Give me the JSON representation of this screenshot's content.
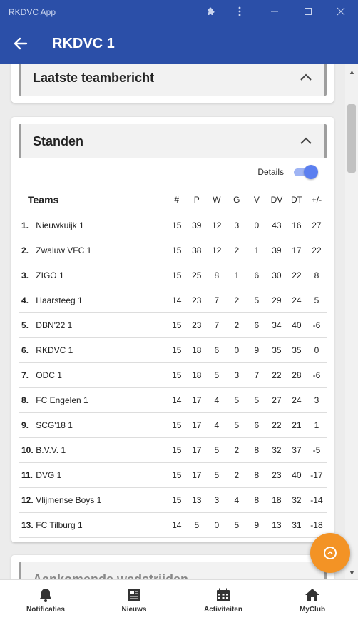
{
  "window": {
    "title": "RKDVC App"
  },
  "appbar": {
    "title": "RKDVC 1"
  },
  "sections": {
    "laatste": {
      "title": "Laatste teambericht"
    },
    "standen": {
      "title": "Standen",
      "details_label": "Details",
      "details_on": true
    },
    "aankomende": {
      "title": "Aankomende wedstrijden"
    }
  },
  "table": {
    "headers": {
      "teams": "Teams",
      "pos": "#",
      "p": "P",
      "w": "W",
      "g": "G",
      "v": "V",
      "dv": "DV",
      "dt": "DT",
      "diff": "+/-"
    },
    "rows": [
      {
        "pos": "1.",
        "team": "Nieuwkuijk 1",
        "played": "15",
        "points": "39",
        "w": "12",
        "g": "3",
        "v": "0",
        "dv": "43",
        "dt": "16",
        "diff": "27"
      },
      {
        "pos": "2.",
        "team": "Zwaluw VFC 1",
        "played": "15",
        "points": "38",
        "w": "12",
        "g": "2",
        "v": "1",
        "dv": "39",
        "dt": "17",
        "diff": "22"
      },
      {
        "pos": "3.",
        "team": "ZIGO 1",
        "played": "15",
        "points": "25",
        "w": "8",
        "g": "1",
        "v": "6",
        "dv": "30",
        "dt": "22",
        "diff": "8"
      },
      {
        "pos": "4.",
        "team": "Haarsteeg 1",
        "played": "14",
        "points": "23",
        "w": "7",
        "g": "2",
        "v": "5",
        "dv": "29",
        "dt": "24",
        "diff": "5"
      },
      {
        "pos": "5.",
        "team": "DBN'22 1",
        "played": "15",
        "points": "23",
        "w": "7",
        "g": "2",
        "v": "6",
        "dv": "34",
        "dt": "40",
        "diff": "-6"
      },
      {
        "pos": "6.",
        "team": "RKDVC 1",
        "played": "15",
        "points": "18",
        "w": "6",
        "g": "0",
        "v": "9",
        "dv": "35",
        "dt": "35",
        "diff": "0"
      },
      {
        "pos": "7.",
        "team": "ODC 1",
        "played": "15",
        "points": "18",
        "w": "5",
        "g": "3",
        "v": "7",
        "dv": "22",
        "dt": "28",
        "diff": "-6"
      },
      {
        "pos": "8.",
        "team": "FC Engelen 1",
        "played": "14",
        "points": "17",
        "w": "4",
        "g": "5",
        "v": "5",
        "dv": "27",
        "dt": "24",
        "diff": "3"
      },
      {
        "pos": "9.",
        "team": "SCG'18 1",
        "played": "15",
        "points": "17",
        "w": "4",
        "g": "5",
        "v": "6",
        "dv": "22",
        "dt": "21",
        "diff": "1"
      },
      {
        "pos": "10.",
        "team": "B.V.V. 1",
        "played": "15",
        "points": "17",
        "w": "5",
        "g": "2",
        "v": "8",
        "dv": "32",
        "dt": "37",
        "diff": "-5"
      },
      {
        "pos": "11.",
        "team": "DVG 1",
        "played": "15",
        "points": "17",
        "w": "5",
        "g": "2",
        "v": "8",
        "dv": "23",
        "dt": "40",
        "diff": "-17"
      },
      {
        "pos": "12.",
        "team": "Vlijmense Boys 1",
        "played": "15",
        "points": "13",
        "w": "3",
        "g": "4",
        "v": "8",
        "dv": "18",
        "dt": "32",
        "diff": "-14"
      },
      {
        "pos": "13.",
        "team": "FC Tilburg 1",
        "played": "14",
        "points": "5",
        "w": "0",
        "g": "5",
        "v": "9",
        "dv": "13",
        "dt": "31",
        "diff": "-18"
      }
    ]
  },
  "nav": {
    "notificaties": "Notificaties",
    "nieuws": "Nieuws",
    "activiteiten": "Activiteiten",
    "myclub": "MyClub"
  },
  "colors": {
    "primary": "#2b4fa8",
    "fab": "#f39325",
    "toggle": "#5b7ff0"
  },
  "icons": [
    "back-arrow-icon",
    "extension-icon",
    "more-vertical-icon",
    "minimize-icon",
    "maximize-icon",
    "close-icon",
    "chevron-up-icon",
    "bell-icon",
    "newspaper-icon",
    "calendar-icon",
    "home-icon"
  ]
}
